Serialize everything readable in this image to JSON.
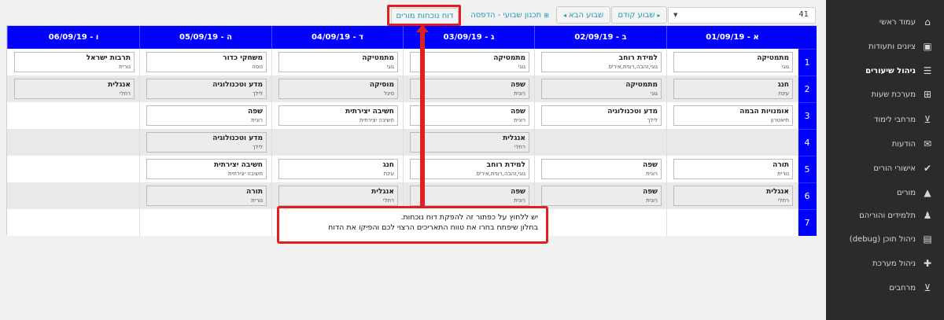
{
  "sidebar": {
    "items": [
      {
        "label": "עמוד ראשי",
        "icon": "home-icon",
        "glyph": "⌂",
        "active": false
      },
      {
        "label": "ציונים ותעודות",
        "icon": "certificate-icon",
        "glyph": "▣",
        "active": false
      },
      {
        "label": "ניהול שיעורים",
        "icon": "list-icon",
        "glyph": "☰",
        "active": true
      },
      {
        "label": "מערכת שעות",
        "icon": "grid-icon",
        "glyph": "⊞",
        "active": false
      },
      {
        "label": "מרחבי לימוד",
        "icon": "cart-icon",
        "glyph": "⊻",
        "active": false
      },
      {
        "label": "הודעות",
        "icon": "envelope-icon",
        "glyph": "✉",
        "active": false
      },
      {
        "label": "אישורי הורים",
        "icon": "user-check-icon",
        "glyph": "✔",
        "active": false
      },
      {
        "label": "מורים",
        "icon": "graduation-cap-icon",
        "glyph": "▲",
        "active": false
      },
      {
        "label": "תלמידים והוריהם",
        "icon": "child-icon",
        "glyph": "♟",
        "active": false
      },
      {
        "label": "ניהול תוכן (debug)",
        "icon": "image-icon",
        "glyph": "▤",
        "active": false
      },
      {
        "label": "ניהול מערכת",
        "icon": "user-plus-icon",
        "glyph": "✚",
        "active": false
      },
      {
        "label": "מרחבים",
        "icon": "cart-icon",
        "glyph": "⊻",
        "active": false
      }
    ]
  },
  "toolbar": {
    "class_select": "41",
    "prev_week": "שבוע קודם",
    "next_week": "שבוע הבא",
    "print_plan": "תכנון שבועי - הדפסה",
    "teacher_attendance": "דוח נוכחות מורים"
  },
  "timetable": {
    "days": [
      "א - 01/09/19",
      "ב - 02/09/19",
      "ג - 03/09/19",
      "ד - 04/09/19",
      "ה - 05/09/19",
      "ו - 06/09/19"
    ],
    "periods": [
      "1",
      "2",
      "3",
      "4",
      "5",
      "6",
      "7"
    ],
    "rows": [
      [
        {
          "subject": "מתמטיקה",
          "teacher": "גוגי"
        },
        {
          "subject": "למידת רוחב",
          "teacher": "גוגי,זהבה,רונית,איריס"
        },
        {
          "subject": "מתמטיקה",
          "teacher": "גוגי"
        },
        {
          "subject": "מתמטיקה",
          "teacher": "גוגי"
        },
        {
          "subject": "משחקי כדור",
          "teacher": "נוסה"
        },
        {
          "subject": "תרבות ישראל",
          "teacher": "נורית"
        }
      ],
      [
        {
          "subject": "חנג",
          "teacher": "עינת"
        },
        {
          "subject": "מתמטיקה",
          "teacher": "גוגי"
        },
        {
          "subject": "שפה",
          "teacher": "רונית"
        },
        {
          "subject": "מוסיקה",
          "teacher": "סיגל"
        },
        {
          "subject": "מדע וטכנולוגיה",
          "teacher": "לילך"
        },
        {
          "subject": "אנגלית",
          "teacher": "רחלי"
        }
      ],
      [
        {
          "subject": "אומנויות הבמה",
          "teacher": "תיאטרון"
        },
        {
          "subject": "מדע וטכנולוגיה",
          "teacher": "לילך"
        },
        {
          "subject": "שפה",
          "teacher": "רונית"
        },
        {
          "subject": "חשיבה יצירתית",
          "teacher": "חשיבה יצירתית"
        },
        {
          "subject": "שפה",
          "teacher": "רונית"
        },
        null
      ],
      [
        null,
        null,
        {
          "subject": "אנגלית",
          "teacher": "רחלי"
        },
        null,
        {
          "subject": "מדע וטכנולוגיה",
          "teacher": "לילך"
        },
        null
      ],
      [
        {
          "subject": "תורה",
          "teacher": "נורית"
        },
        {
          "subject": "שפה",
          "teacher": "רונית"
        },
        {
          "subject": "למידת רוחב",
          "teacher": "גוגי,זהבה,רונית,איריס"
        },
        {
          "subject": "חנג",
          "teacher": "עינת"
        },
        {
          "subject": "חשיבה יצירתית",
          "teacher": "חשיבה יצירתית"
        },
        null
      ],
      [
        {
          "subject": "אנגלית",
          "teacher": "רחלי"
        },
        {
          "subject": "שפה",
          "teacher": "רונית"
        },
        {
          "subject": "שפה",
          "teacher": "רונית"
        },
        {
          "subject": "אנגלית",
          "teacher": "רחלי"
        },
        {
          "subject": "תורה",
          "teacher": "נורית"
        },
        null
      ],
      [
        null,
        null,
        null,
        null,
        null,
        null
      ]
    ]
  },
  "callout": {
    "line1": "יש ללחוץ על כפתור זה להפקת דוח נוכחות.",
    "line2": "בחלון שיפתח בחרו את טווח התאריכים הרצוי לכם והפיקו את הדוח"
  },
  "colors": {
    "header_blue": "#0000ff",
    "highlight_red": "#e02020",
    "sidebar_bg": "#2b2b2b",
    "button_text": "#1a9bb1"
  }
}
